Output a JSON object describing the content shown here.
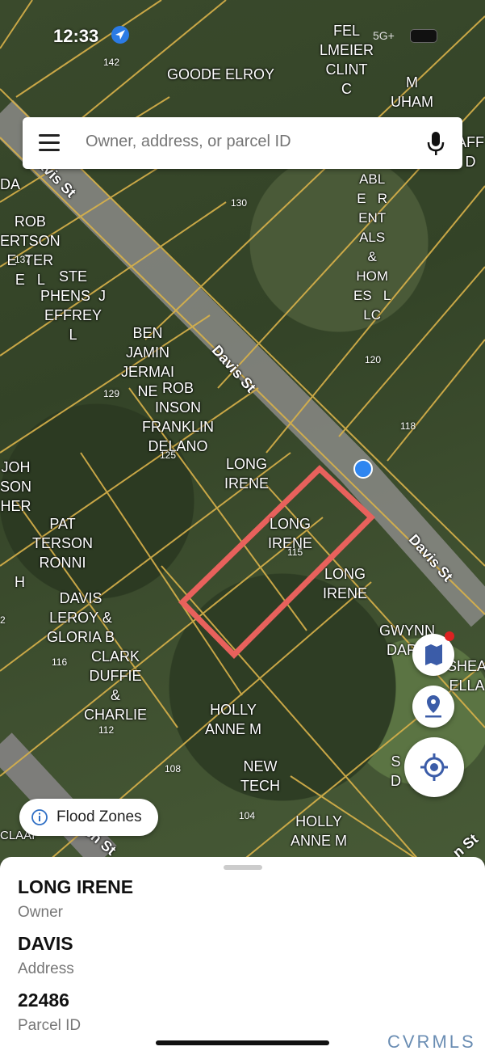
{
  "status_bar": {
    "time": "12:33",
    "network": "5G+"
  },
  "search": {
    "placeholder": "Owner, address, or parcel ID"
  },
  "map": {
    "owner_labels": [
      "GOODE ELROY",
      "FEL\nLMEIER\nCLINT\nC",
      "M\nUHAM",
      "ROB\nERTSON\nE  TER\nE   L",
      "STE\nPHENS  J\nEFFREY\nL",
      "BEN\nJAMIN\nJERMAI\nNE",
      "ROB\nINSON\nFRANKLIN\nDELANO",
      "LONG\nIRENE",
      "LONG\nIRENE",
      "LONG\nIRENE",
      "JOH\nSON\nHER",
      "PAT\nTERSON\nRONNI",
      "DAVIS\nLEROY &\nGLORIA B",
      "CLARK\nDUFFIE\n&\nCHARLIE",
      "HOLLY\nANNE M",
      "NEW\nTECH",
      "HOLLY\nANNE M",
      "GWYNN\nDARR",
      "ABL\nE   R\nENT\nALS\n&\nHOM\nES   L\nLC",
      "SHEA\nELLA",
      "AFF\nD",
      "DA",
      "H",
      "CLAAI",
      "S\nD"
    ],
    "house_numbers": [
      "142",
      "130",
      "137",
      "129",
      "125",
      "120",
      "118",
      "115",
      "116",
      "112",
      "108",
      "104",
      "2"
    ],
    "streets": [
      "Davis St",
      "Davis St",
      "Davis St",
      "en St",
      "n St"
    ]
  },
  "flood_button": {
    "label": "Flood Zones"
  },
  "parcel": {
    "owner_value": "LONG IRENE",
    "owner_caption": "Owner",
    "address_value": "DAVIS",
    "address_caption": "Address",
    "id_value": "22486",
    "id_caption": "Parcel ID"
  },
  "brand": "CVRMLS",
  "colors": {
    "parcel_line": "#d9b24a",
    "selected_parcel": "#e8615c",
    "location_dot": "#2f86f0"
  }
}
